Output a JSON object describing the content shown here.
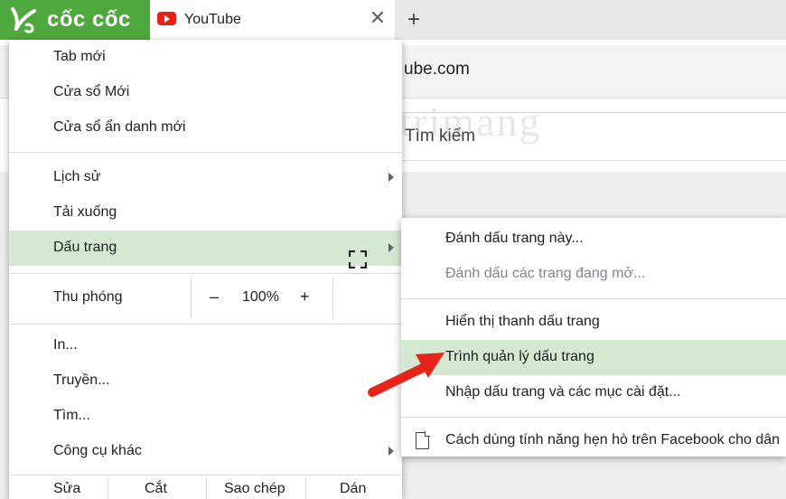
{
  "browser": {
    "brand": "cốc cốc",
    "tab_title": "YouTube",
    "tab_close": "✕",
    "new_tab": "+",
    "url_fragment": "ube.com",
    "search_placeholder": "Tìm kiếm",
    "watermark": "uantrimang",
    "accent_color": "#4fa83d"
  },
  "menu": {
    "new_tab": "Tab mới",
    "new_window": "Cửa sổ Mới",
    "incognito": "Cửa sổ ẩn danh mới",
    "history": "Lịch sử",
    "downloads": "Tải xuống",
    "bookmarks": "Dấu trang",
    "zoom": {
      "label": "Thu phóng",
      "minus": "–",
      "value": "100%",
      "plus": "+"
    },
    "print": "In...",
    "cast": "Truyền...",
    "find": "Tìm...",
    "more_tools": "Công cụ khác",
    "edit": {
      "label": "Sửa",
      "cut": "Cắt",
      "copy": "Sao chép",
      "paste": "Dán"
    }
  },
  "bookmarks_submenu": {
    "bookmark_page": "Đánh dấu trang này...",
    "bookmark_open": "Đánh dấu các trang đang mở...",
    "show_bar": "Hiển thị thanh dấu trang",
    "manager": "Trình quản lý dấu trang",
    "import": "Nhập dấu trang và các mục cài đặt...",
    "facebook_item": "Cách dùng tính năng hẹn hò trên Facebook cho dân"
  },
  "highlight_color": "#d5e9d2",
  "arrow_color": "#e8231b"
}
